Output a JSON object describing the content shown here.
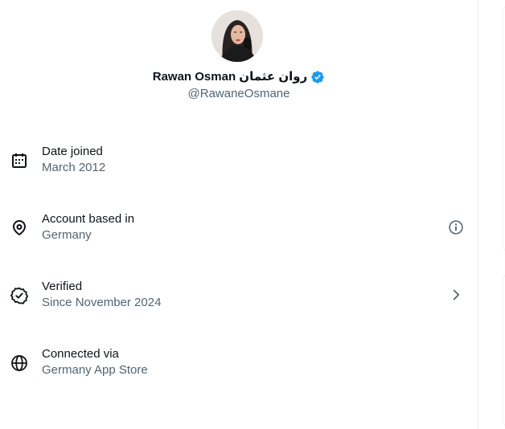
{
  "profile": {
    "display_name": "Rawan Osman روان عثمان",
    "handle": "@RawaneOsmane"
  },
  "rows": [
    {
      "title": "Date joined",
      "value": "March 2012",
      "icon": "calendar-icon"
    },
    {
      "title": "Account based in",
      "value": "Germany",
      "icon": "location-pin-icon",
      "trailing_icon": "info-icon"
    },
    {
      "title": "Verified",
      "value": "Since November 2024",
      "icon": "verified-check-icon",
      "trailing_icon": "chevron-right-icon"
    },
    {
      "title": "Connected via",
      "value": "Germany App Store",
      "icon": "globe-icon"
    }
  ],
  "colors": {
    "primary_text": "#0f1419",
    "secondary_text": "#536471",
    "verified_blue": "#1d9bf0",
    "border": "#eff3f4"
  }
}
